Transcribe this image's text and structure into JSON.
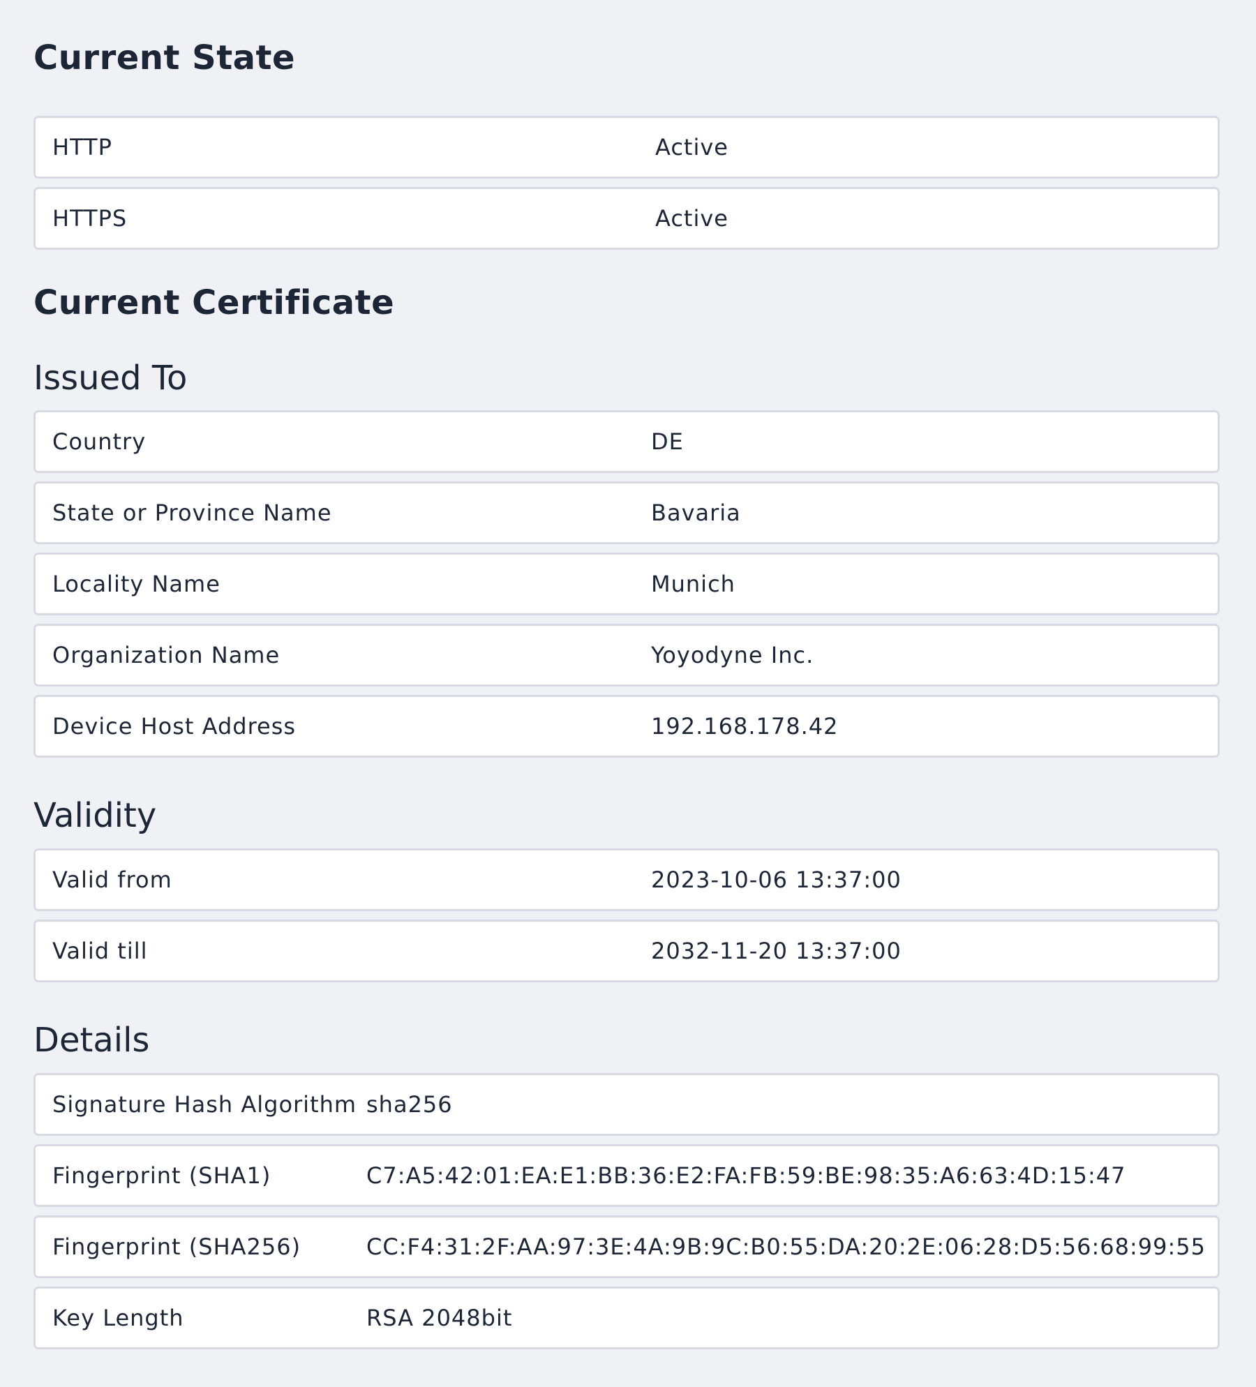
{
  "current_state": {
    "title": "Current State",
    "rows": [
      {
        "key": "HTTP",
        "value": "Active"
      },
      {
        "key": "HTTPS",
        "value": "Active"
      }
    ]
  },
  "current_certificate": {
    "title": "Current Certificate",
    "issued_to": {
      "title": "Issued To",
      "rows": [
        {
          "key": "Country",
          "value": "DE"
        },
        {
          "key": "State or Province Name",
          "value": "Bavaria"
        },
        {
          "key": "Locality Name",
          "value": "Munich"
        },
        {
          "key": "Organization Name",
          "value": "Yoyodyne Inc."
        },
        {
          "key": "Device Host Address",
          "value": "192.168.178.42"
        }
      ]
    },
    "validity": {
      "title": "Validity",
      "rows": [
        {
          "key": "Valid from",
          "value": "2023-10-06 13:37:00"
        },
        {
          "key": "Valid till",
          "value": "2032-11-20 13:37:00"
        }
      ]
    },
    "details": {
      "title": "Details",
      "rows": [
        {
          "key": "Signature Hash Algorithm",
          "value": "sha256"
        },
        {
          "key": "Fingerprint (SHA1)",
          "value": "C7:A5:42:01:EA:E1:BB:36:E2:FA:FB:59:BE:98:35:A6:63:4D:15:47"
        },
        {
          "key": "Fingerprint (SHA256)",
          "value": "CC:F4:31:2F:AA:97:3E:4A:9B:9C:B0:55:DA:20:2E:06:28:D5:56:68:99:55"
        },
        {
          "key": "Key Length",
          "value": "RSA 2048bit"
        }
      ]
    }
  }
}
